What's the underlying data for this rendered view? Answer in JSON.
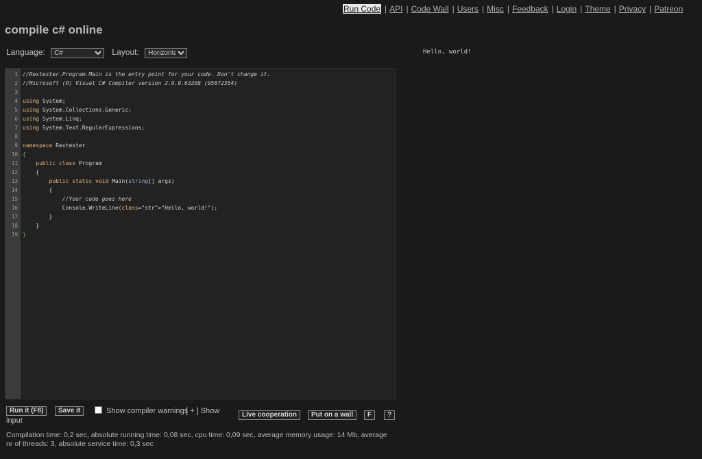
{
  "nav": {
    "items": [
      {
        "label": "Run Code",
        "active": true
      },
      {
        "label": "API"
      },
      {
        "label": "Code Wall"
      },
      {
        "label": "Users"
      },
      {
        "label": "Misc"
      },
      {
        "label": "Feedback"
      },
      {
        "label": "Login"
      },
      {
        "label": "Theme"
      },
      {
        "label": "Privacy"
      },
      {
        "label": "Patreon"
      }
    ],
    "separator": "|"
  },
  "page_title": "compile c# online",
  "controls": {
    "language_label": "Language:",
    "language_value": "C#",
    "layout_label": "Layout:",
    "layout_value": "Horizontal"
  },
  "output": {
    "text": "Hello, world!"
  },
  "editor": {
    "line_numbers": [
      "1",
      "2",
      "3",
      "4",
      "5",
      "6",
      "7",
      "8",
      "9",
      "10",
      "11",
      "12",
      "13",
      "14",
      "15",
      "16",
      "17",
      "18",
      "19"
    ],
    "lines": [
      "//Rextester.Program.Main is the entry point for your code. Don't change it.",
      "//Microsoft (R) Visual C# Compiler version 2.9.0.63208 (958f2354)",
      "",
      "using System;",
      "using System.Collections.Generic;",
      "using System.Linq;",
      "using System.Text.RegularExpressions;",
      "",
      "namespace Rextester",
      "{",
      "    public class Program",
      "    {",
      "        public static void Main(string[] args)",
      "        {",
      "            //Your code goes here",
      "            Console.WriteLine(\"Hello, world!\");",
      "        }",
      "    }",
      "}"
    ]
  },
  "bottom": {
    "run_label": "Run it (F8)",
    "save_label": "Save it",
    "warnings_label": "Show compiler warnings",
    "show_input_first": "[ + ] Show",
    "show_input_rest": "input",
    "live_label": "Live cooperation",
    "wall_label": "Put on a wall",
    "f_label": "F",
    "help_label": "?"
  },
  "stats": {
    "text": "Compilation time: 0,2 sec, absolute running time: 0,08 sec, cpu time: 0,09 sec, average memory usage: 14 Mb, average nr of threads: 3, absolute service time: 0,3 sec"
  }
}
